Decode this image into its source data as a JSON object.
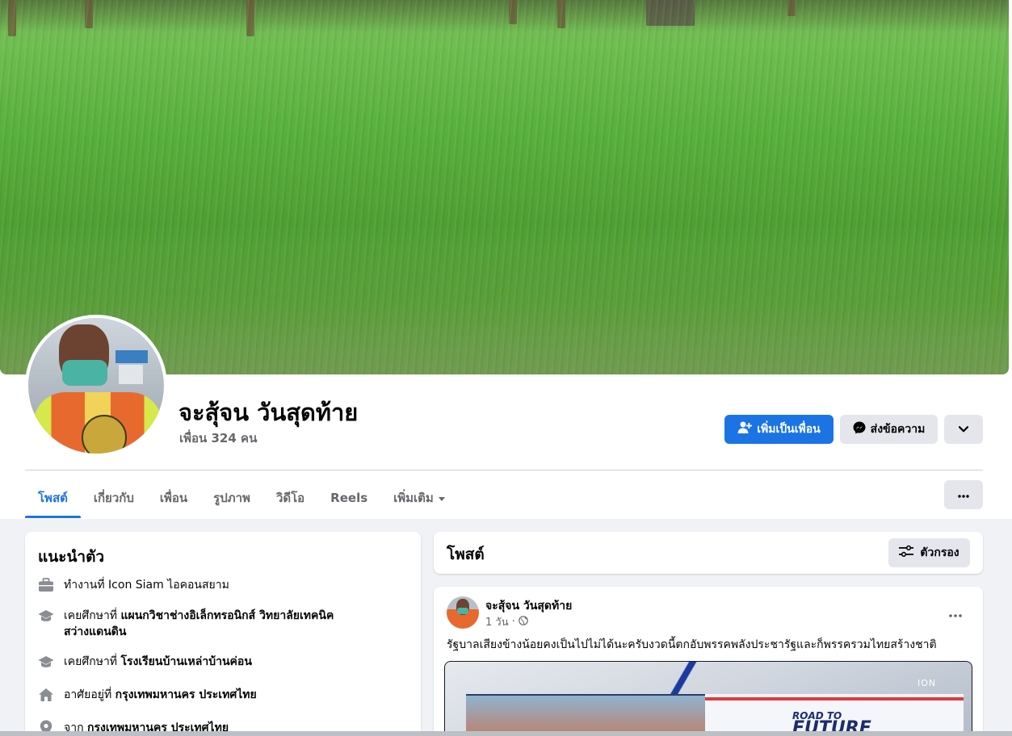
{
  "profile": {
    "name": "จะสุ้จน วันสุดท้าย",
    "friends_text": "เพื่อน 324 คน"
  },
  "actions": {
    "add_friend": "เพิ่มเป็นเพื่อน",
    "message": "ส่งข้อความ"
  },
  "tabs": [
    {
      "label": "โพสต์",
      "active": true
    },
    {
      "label": "เกี่ยวกับ"
    },
    {
      "label": "เพื่อน"
    },
    {
      "label": "รูปภาพ"
    },
    {
      "label": "วิดีโอ"
    },
    {
      "label": "Reels"
    },
    {
      "label": "เพิ่มเติม"
    }
  ],
  "intro": {
    "title": "แนะนำตัว",
    "items": [
      {
        "icon": "briefcase-icon",
        "prefix": "ทำงานที่ ",
        "value": "Icon Siam ไอคอนสยาม"
      },
      {
        "icon": "graduation-cap-icon",
        "prefix": "เคยศึกษาที่ ",
        "value": "แผนกวิชาช่างอิเล็กทรอนิกส์ วิทยาลัยเทคนิค",
        "value2": "สว่างแดนดิน"
      },
      {
        "icon": "graduation-cap-icon",
        "prefix": "เคยศึกษาที่ ",
        "value": "โรงเรียนบ้านเหล่าบ้านค่อน"
      },
      {
        "icon": "home-icon",
        "prefix": "อาศัยอยู่ที่ ",
        "value": "กรุงเทพมหานคร ประเทศไทย"
      },
      {
        "icon": "location-pin-icon",
        "prefix": "จาก ",
        "value": "กรุงเทพมหานคร ประเทศไทย"
      }
    ]
  },
  "posts_header": {
    "title": "โพสต์",
    "filter_label": "ตัวกรอง"
  },
  "post": {
    "author": "จะสุ้จน วันสุดท้าย",
    "time": "1 วัน",
    "text": "รัฐบาลเสียงข้างน้อยคงเป็นไปไม่ได้นะครับงวดนี้ตกอับพรรคพลังประชารัฐและก็พรรครวมไทยสร้างชาติ",
    "media_text_1": "ROAD TO",
    "media_text_2": "FUTURE",
    "media_logo": "ION"
  },
  "colors": {
    "accent": "#1b74e4",
    "secondary_button": "#e4e6eb",
    "muted_text": "#65676b",
    "page_bg": "#f0f2f5"
  }
}
